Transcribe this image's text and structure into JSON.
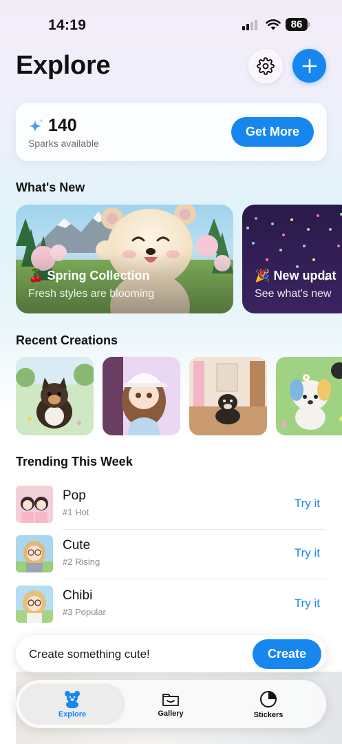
{
  "status_bar": {
    "time": "14:19",
    "battery": "86"
  },
  "header": {
    "title": "Explore",
    "settings_icon": "gear-icon",
    "add_icon": "plus-icon"
  },
  "sparks": {
    "count": "140",
    "caption": "Sparks available",
    "button": "Get More",
    "icon": "sparkles-icon"
  },
  "whats_new": {
    "title": "What's New",
    "cards": [
      {
        "emoji": "🍒",
        "title": "Spring Collection",
        "subtitle": "Fresh styles are blooming"
      },
      {
        "emoji": "🎉",
        "title": "New updat",
        "subtitle": "See what's new"
      }
    ]
  },
  "recent": {
    "title": "Recent Creations"
  },
  "trending": {
    "title": "Trending This Week",
    "items": [
      {
        "name": "Pop",
        "rank": "#1 Hot",
        "action": "Try it"
      },
      {
        "name": "Cute",
        "rank": "#2 Rising",
        "action": "Try it"
      },
      {
        "name": "Chibi",
        "rank": "#3 Popular",
        "action": "Try it"
      }
    ]
  },
  "create_bar": {
    "prompt": "Create something cute!",
    "button": "Create"
  },
  "tabs": [
    {
      "label": "Explore",
      "icon": "bear-icon",
      "active": true
    },
    {
      "label": "Gallery",
      "icon": "folder-icon",
      "active": false
    },
    {
      "label": "Stickers",
      "icon": "sticker-icon",
      "active": false
    }
  ],
  "colors": {
    "accent": "#1787ef"
  }
}
